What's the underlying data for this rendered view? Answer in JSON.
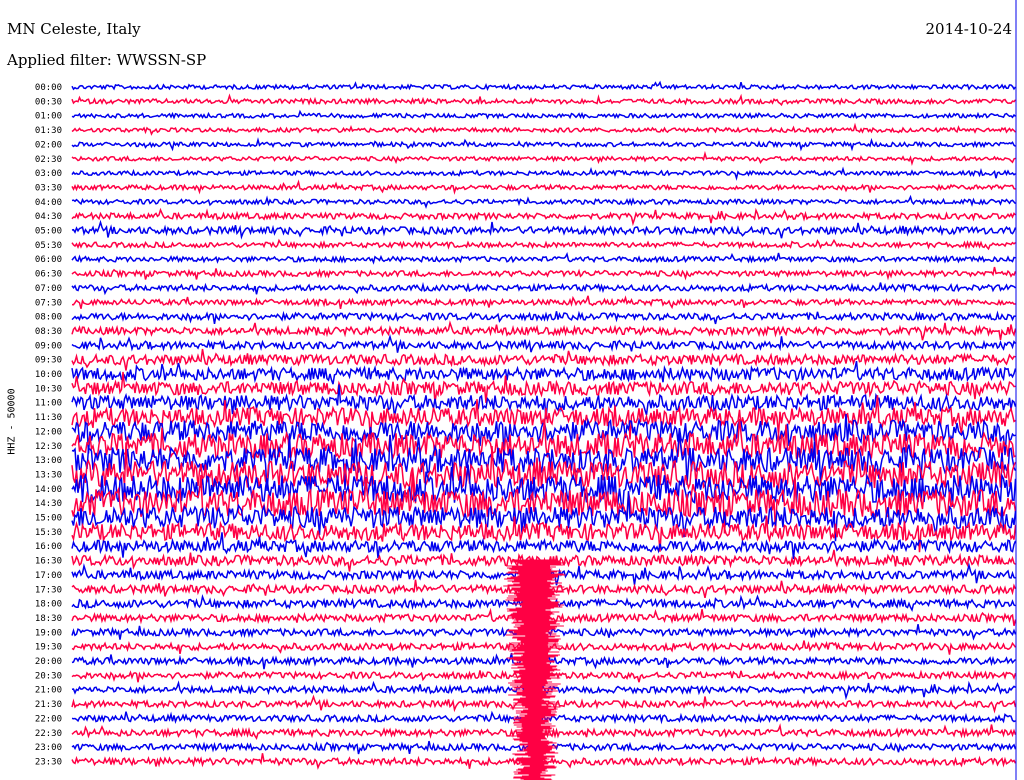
{
  "header": {
    "station": "MN Celeste, Italy",
    "date": "2014-10-24",
    "filter": "Applied filter: WWSSN-SP"
  },
  "chart_data": {
    "type": "line",
    "title": "MN Celeste, Italy",
    "subtitle": "Applied filter: WWSSN-SP",
    "ylabel": "HHZ - 50000",
    "row_labels": [
      "00:00",
      "00:30",
      "01:00",
      "01:30",
      "02:00",
      "02:30",
      "03:00",
      "03:30",
      "04:00",
      "04:30",
      "05:00",
      "05:30",
      "06:00",
      "06:30",
      "07:00",
      "07:30",
      "08:00",
      "08:30",
      "09:00",
      "09:30",
      "10:00",
      "10:30",
      "11:00",
      "11:30",
      "12:00",
      "12:30",
      "13:00",
      "13:30",
      "14:00",
      "14:30",
      "15:00",
      "15:30",
      "16:00",
      "16:30",
      "17:00",
      "17:30",
      "18:00",
      "18:30",
      "19:00",
      "19:30",
      "20:00",
      "20:30",
      "21:00",
      "21:30",
      "22:00",
      "22:30",
      "23:00",
      "23:30"
    ],
    "row_intensity": [
      0.5,
      0.55,
      0.5,
      0.5,
      0.5,
      0.5,
      0.5,
      0.55,
      0.55,
      0.7,
      0.85,
      0.6,
      0.6,
      0.65,
      0.7,
      0.65,
      0.8,
      0.9,
      0.9,
      1.2,
      1.5,
      1.6,
      1.8,
      2.2,
      2.6,
      3.0,
      3.0,
      3.2,
      3.3,
      3.3,
      2.6,
      2.0,
      1.4,
      1.2,
      1.0,
      0.95,
      0.95,
      0.85,
      0.8,
      0.8,
      0.8,
      0.75,
      0.75,
      0.75,
      0.75,
      0.8,
      0.75,
      0.8
    ],
    "colors": [
      "#0000ee",
      "#ff0044"
    ],
    "grid": false
  }
}
